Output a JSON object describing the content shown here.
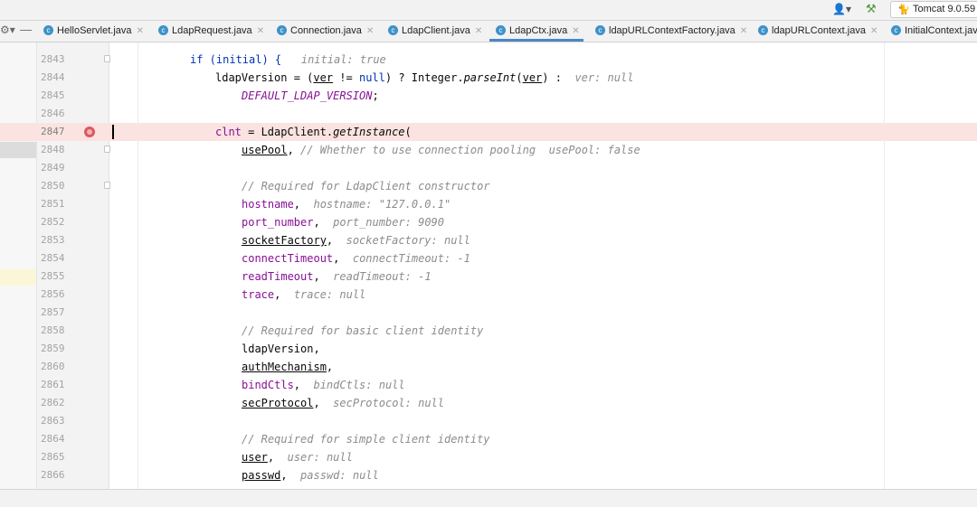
{
  "toolbar": {
    "run_config": "Tomcat 9.0.59",
    "user_icon": "user-icon",
    "build_icon": "hammer-icon"
  },
  "tabs": [
    {
      "label": "HelloServlet.java",
      "active": false
    },
    {
      "label": "LdapRequest.java",
      "active": false
    },
    {
      "label": "Connection.java",
      "active": false
    },
    {
      "label": "LdapClient.java",
      "active": false
    },
    {
      "label": "LdapCtx.java",
      "active": true
    },
    {
      "label": "ldapURLContextFactory.java",
      "active": false
    },
    {
      "label": "ldapURLContext.java",
      "active": false
    },
    {
      "label": "InitialContext.jav",
      "active": false
    }
  ],
  "colors": {
    "accent": "#4a88c7",
    "breakpoint": "#db5860",
    "keyword": "#0033b3",
    "field": "#871094",
    "comment": "#8c8c8c",
    "current_line": "#fae3e1"
  },
  "editor": {
    "breakpoint_line": "2847",
    "lines": [
      {
        "num": "2843"
      },
      {
        "num": "2844"
      },
      {
        "num": "2845"
      },
      {
        "num": "2846"
      },
      {
        "num": "2847"
      },
      {
        "num": "2848"
      },
      {
        "num": "2849"
      },
      {
        "num": "2850"
      },
      {
        "num": "2851"
      },
      {
        "num": "2852"
      },
      {
        "num": "2853"
      },
      {
        "num": "2854"
      },
      {
        "num": "2855"
      },
      {
        "num": "2856"
      },
      {
        "num": "2857"
      },
      {
        "num": "2858"
      },
      {
        "num": "2859"
      },
      {
        "num": "2860"
      },
      {
        "num": "2861"
      },
      {
        "num": "2862"
      },
      {
        "num": "2863"
      },
      {
        "num": "2864"
      },
      {
        "num": "2865"
      },
      {
        "num": "2866"
      }
    ],
    "tokens": {
      "l2843": {
        "t1": "if (initial) {",
        "hint": "initial: true"
      },
      "l2844": {
        "t1": "ldapVersion = (",
        "t2": "ver",
        "t3": " != ",
        "t4": "null",
        "t5": ") ? Integer.",
        "t6": "parseInt",
        "t7": "(",
        "t8": "ver",
        "t9": ") :",
        "hint": "ver: null"
      },
      "l2845": {
        "t1": "DEFAULT_LDAP_VERSION",
        "t2": ";"
      },
      "l2847": {
        "t1": "clnt",
        "t2": " = LdapClient.",
        "t3": "getInstance",
        "t4": "("
      },
      "l2848": {
        "t1": "usePool",
        "t2": ", ",
        "cm": "// Whether to use connection pooling",
        "hint": "usePool: false"
      },
      "l2850": {
        "cm": "// Required for LdapClient constructor"
      },
      "l2851": {
        "t1": "hostname",
        "t2": ",",
        "hint": "hostname: \"127.0.0.1\""
      },
      "l2852": {
        "t1": "port_number",
        "t2": ",",
        "hint": "port_number: 9090"
      },
      "l2853": {
        "t1": "socketFactory",
        "t2": ",",
        "hint": "socketFactory: null"
      },
      "l2854": {
        "t1": "connectTimeout",
        "t2": ",",
        "hint": "connectTimeout: -1"
      },
      "l2855": {
        "t1": "readTimeout",
        "t2": ",",
        "hint": "readTimeout: -1"
      },
      "l2856": {
        "t1": "trace",
        "t2": ",",
        "hint": "trace: null"
      },
      "l2858": {
        "cm": "// Required for basic client identity"
      },
      "l2859": {
        "t1": "ldapVersion",
        "t2": ","
      },
      "l2860": {
        "t1": "authMechanism",
        "t2": ","
      },
      "l2861": {
        "t1": "bindCtls",
        "t2": ",",
        "hint": "bindCtls: null"
      },
      "l2862": {
        "t1": "secProtocol",
        "t2": ",",
        "hint": "secProtocol: null"
      },
      "l2864": {
        "cm": "// Required for simple client identity"
      },
      "l2865": {
        "t1": "user",
        "t2": ",",
        "hint": "user: null"
      },
      "l2866": {
        "t1": "passwd",
        "t2": ",",
        "hint": "passwd: null"
      }
    }
  }
}
